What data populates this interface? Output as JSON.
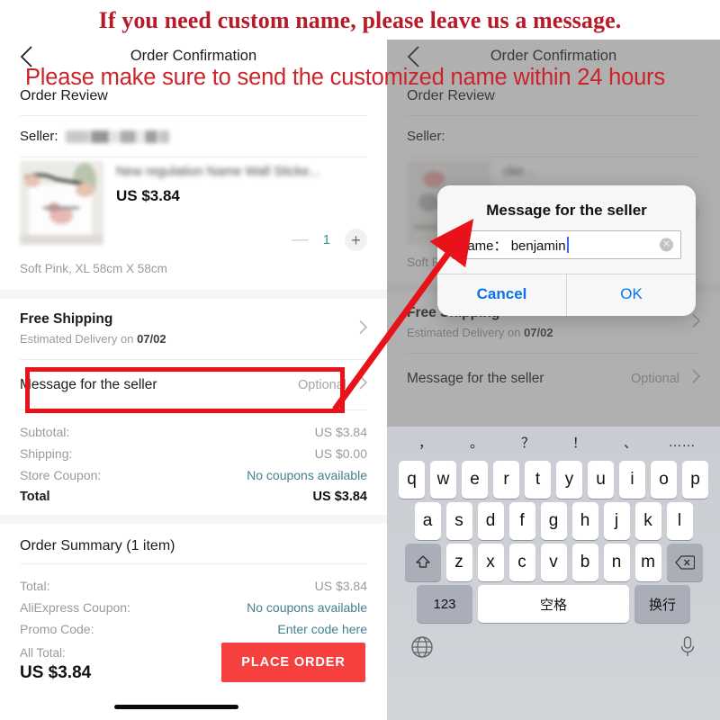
{
  "annotations": {
    "headline_top": "If you need custom name, please leave us a message.",
    "headline_sub": "Please make sure to send the customized name within 24 hours",
    "headline_top_color": "#b81a29",
    "headline_sub_color": "#cc2229",
    "highlight_box_color": "#e8131a",
    "arrow_color": "#e8131a",
    "highlight_target": "Message for the seller",
    "arrow_points_to": "name: benjamin"
  },
  "left_screen": {
    "nav": {
      "back_icon": "chevron-left-icon",
      "title": "Order Confirmation"
    },
    "order_review": {
      "section_title": "Order Review",
      "seller_label": "Seller:",
      "seller_name_redacted": true,
      "product": {
        "name": "New regulation Name Wall Sticke...",
        "price": "US $3.84",
        "quantity": "1",
        "minus_label": "—",
        "plus_label": "+",
        "variant": "Soft Pink, XL 58cm X 58cm",
        "image_alt": "hands-holding-wall-sticker-sheet"
      }
    },
    "shipping": {
      "title": "Free Shipping",
      "subtitle_prefix": "Estimated Delivery on ",
      "subtitle_date": "07/02"
    },
    "message_row": {
      "label": "Message for the seller",
      "value": "Optional"
    },
    "totals": [
      {
        "key": "Subtotal:",
        "value": "US $3.84",
        "link": false,
        "strong": false
      },
      {
        "key": "Shipping:",
        "value": "US $0.00",
        "link": false,
        "strong": false
      },
      {
        "key": "Store Coupon:",
        "value": "No coupons available",
        "link": true,
        "strong": false
      },
      {
        "key": "Total",
        "value": "US $3.84",
        "link": false,
        "strong": true
      }
    ],
    "summary": {
      "title": "Order Summary (1 item)",
      "rows": [
        {
          "key": "Total:",
          "value": "US $3.84",
          "link": false
        },
        {
          "key": "AliExpress Coupon:",
          "value": "No coupons available",
          "link": true
        },
        {
          "key": "Promo Code:",
          "value": "Enter code here",
          "link": true
        }
      ]
    },
    "bottom_bar": {
      "all_total_label": "All Total:",
      "all_total_value": "US $3.84",
      "place_order_label": "PLACE ORDER",
      "place_order_color": "#f5403f"
    }
  },
  "right_screen": {
    "nav": {
      "back_icon": "chevron-left-icon",
      "title": "Order Confirmation"
    },
    "order_review_title": "Order Review",
    "seller_label": "Seller:",
    "product_name_tail": "cke...",
    "variant": "Soft Pink, XL 58cm X 58cm",
    "shipping": {
      "title": "Free Shipping",
      "subtitle_prefix": "Estimated Delivery on ",
      "subtitle_date": "07/02"
    },
    "message_row": {
      "label": "Message for the seller",
      "value": "Optional"
    },
    "plus_label": "+",
    "dialog": {
      "title": "Message for the seller",
      "input_value": "name： benjamin",
      "clear_icon": "clear-circle-icon",
      "cancel_label": "Cancel",
      "ok_label": "OK",
      "button_color": "#0a72e8"
    },
    "keyboard": {
      "punctuation": [
        "，",
        "。",
        "？",
        "！",
        "、",
        "……"
      ],
      "row1": [
        "q",
        "w",
        "e",
        "r",
        "t",
        "y",
        "u",
        "i",
        "o",
        "p"
      ],
      "row2": [
        "a",
        "s",
        "d",
        "f",
        "g",
        "h",
        "j",
        "k",
        "l"
      ],
      "row3": [
        "z",
        "x",
        "c",
        "v",
        "b",
        "n",
        "m"
      ],
      "shift_icon": "shift-up-icon",
      "backspace_icon": "backspace-icon",
      "numeric_label": "123",
      "space_label": "空格",
      "return_label": "换行",
      "globe_icon": "globe-icon",
      "mic_icon": "microphone-icon"
    }
  }
}
